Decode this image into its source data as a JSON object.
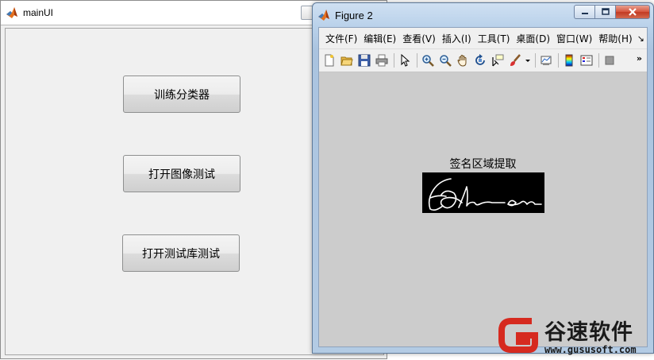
{
  "main_window": {
    "title": "mainUI",
    "buttons": {
      "train": "训练分类器",
      "open_image": "打开图像测试",
      "open_db": "打开测试库测试"
    }
  },
  "figure_window": {
    "title": "Figure 2",
    "menu": [
      "文件(F)",
      "编辑(E)",
      "查看(V)",
      "插入(I)",
      "工具(T)",
      "桌面(D)",
      "窗口(W)",
      "帮助(H)"
    ],
    "menu_overflow_icon": "double-chevron-right-icon",
    "toolbar_icons": [
      "new-figure-icon",
      "open-file-icon",
      "save-icon",
      "print-icon",
      "pointer-icon",
      "zoom-in-icon",
      "zoom-out-icon",
      "pan-hand-icon",
      "rotate-3d-icon",
      "data-cursor-icon",
      "brush-icon",
      "link-plot-icon",
      "colorbar-icon",
      "legend-icon",
      "plot-tools-icon"
    ],
    "axes_title": "签名区域提取"
  },
  "watermark": {
    "name": "谷速软件",
    "url": "www.gususoft.com",
    "accent": "#d62a1f"
  },
  "colors": {
    "matlab_orange": "#e4701e",
    "close_red": "#c9432b",
    "plot_bg": "#cccccc",
    "window_bg": "#f0f0f0"
  }
}
